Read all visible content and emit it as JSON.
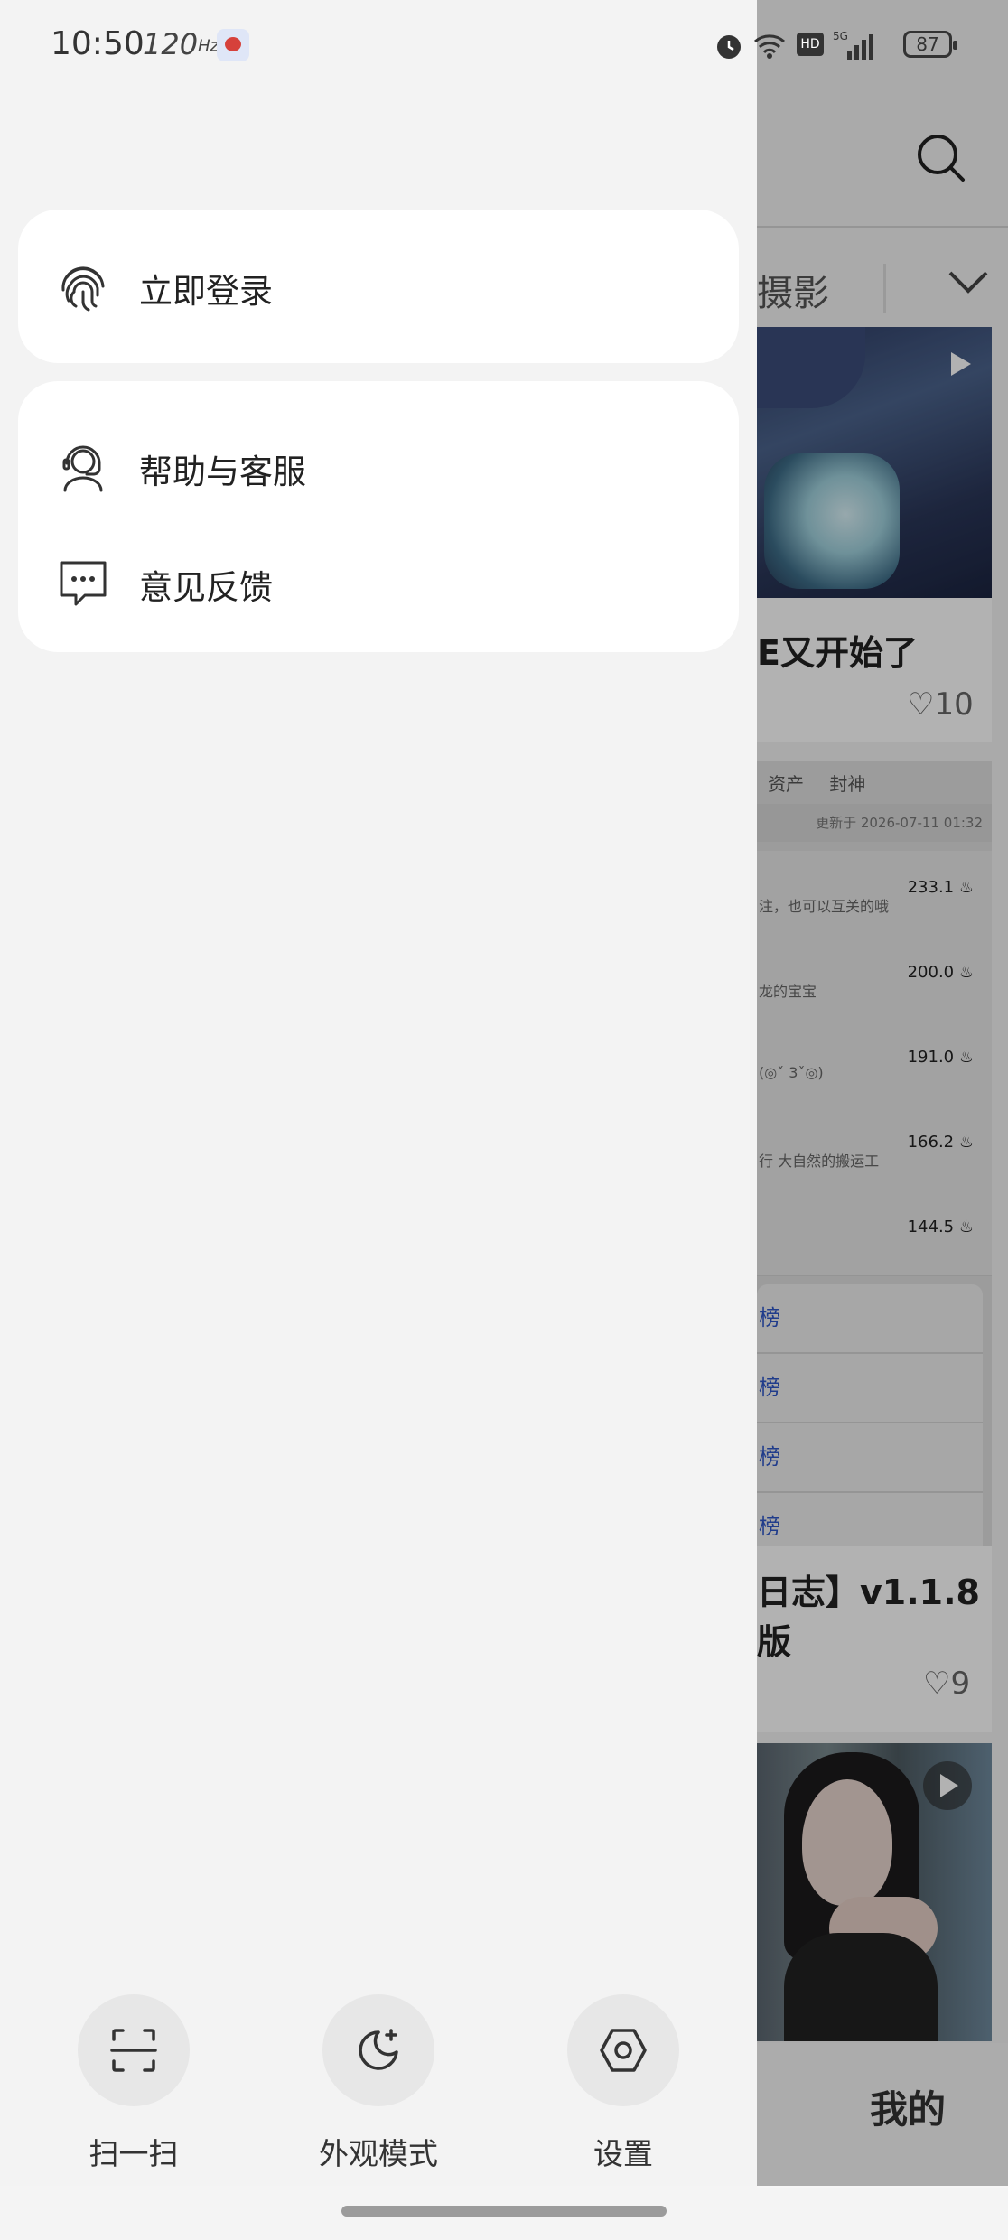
{
  "status_bar": {
    "time": "10:50",
    "refresh_rate": "120",
    "battery": "87"
  },
  "drawer": {
    "login_label": "立即登录",
    "menu_items": [
      {
        "label": "帮助与客服",
        "icon": "headset-agent-icon"
      },
      {
        "label": "意见反馈",
        "icon": "chat-bubble-icon"
      }
    ],
    "bottom_actions": [
      {
        "label": "扫一扫",
        "icon": "scan-icon"
      },
      {
        "label": "外观模式",
        "icon": "moon-icon"
      },
      {
        "label": "设置",
        "icon": "settings-hexagon-icon"
      }
    ]
  },
  "background": {
    "tab_visible": "摄影",
    "post1_title": "E又开始了",
    "post1_likes": "10",
    "ranking": {
      "tabs": [
        "资产",
        "封神"
      ],
      "updated": "更新于 2026-07-11 01:32",
      "rows": [
        {
          "desc": "注，也可以互关的哦",
          "value": "233.1"
        },
        {
          "desc": "龙的宝宝",
          "value": "200.0"
        },
        {
          "desc": "(◎ˇ 3ˇ◎)",
          "value": "191.0"
        },
        {
          "desc": "行 大自然的搬运工",
          "value": "166.2"
        },
        {
          "desc": "",
          "value": "144.5"
        }
      ],
      "list": [
        "榜",
        "榜",
        "榜",
        "榜"
      ]
    },
    "post2_title": "日志】v1.1.8版",
    "post2_likes": "9",
    "bottom_tab": "我的"
  },
  "colors": {
    "drawer_bg": "#f3f3f3",
    "panel_bg": "#ffffff",
    "link_blue": "#2f57c8"
  }
}
